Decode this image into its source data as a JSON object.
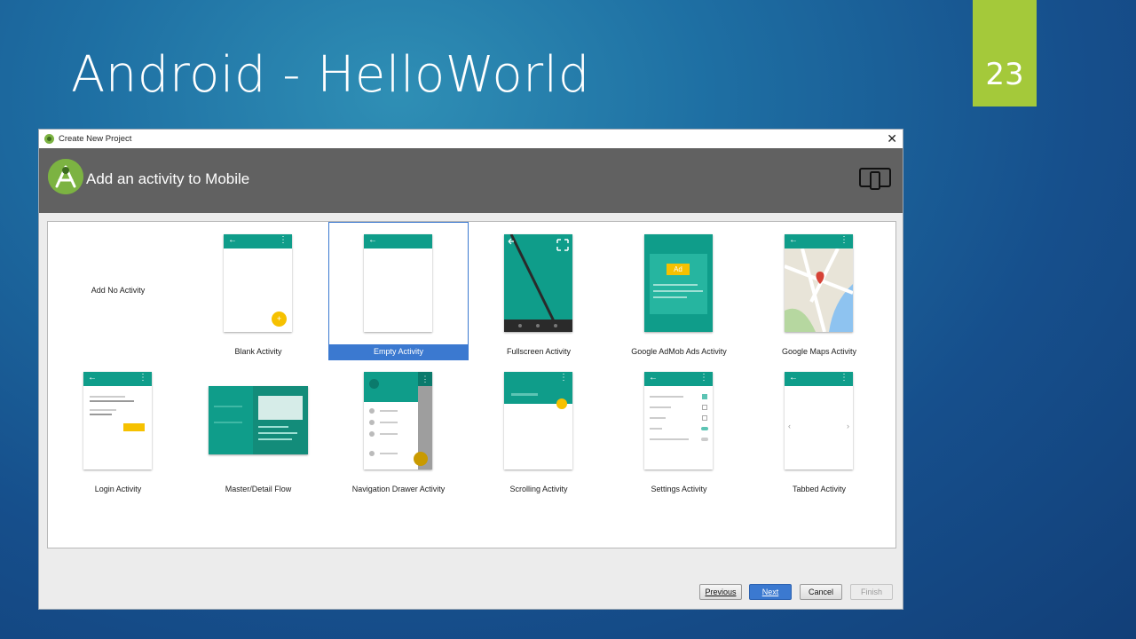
{
  "slide": {
    "title": "Android - HelloWorld",
    "page_number": "23"
  },
  "window": {
    "title": "Create New Project",
    "header_title": "Add an activity to Mobile"
  },
  "activities": [
    {
      "label": "Add No Activity"
    },
    {
      "label": "Blank Activity"
    },
    {
      "label": "Empty Activity",
      "selected": true
    },
    {
      "label": "Fullscreen Activity"
    },
    {
      "label": "Google AdMob Ads Activity",
      "ad_text": "Ad"
    },
    {
      "label": "Google Maps Activity"
    },
    {
      "label": "Login Activity"
    },
    {
      "label": "Master/Detail Flow"
    },
    {
      "label": "Navigation Drawer Activity"
    },
    {
      "label": "Scrolling Activity"
    },
    {
      "label": "Settings Activity"
    },
    {
      "label": "Tabbed Activity"
    }
  ],
  "buttons": {
    "previous": "Previous",
    "next": "Next",
    "cancel": "Cancel",
    "finish": "Finish"
  },
  "colors": {
    "accent_green": "#a4c93a",
    "teal": "#0f9d8a",
    "selection_blue": "#3b79d0",
    "header_gray": "#616161"
  }
}
